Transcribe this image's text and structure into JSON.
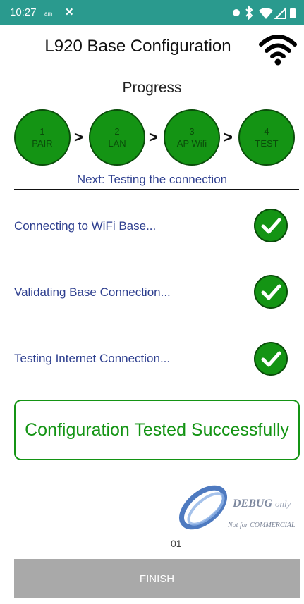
{
  "status_bar": {
    "time": "10:27",
    "ampm": "am",
    "notification_icon": "x-icon",
    "right_icons": [
      "dot-icon",
      "bluetooth-icon",
      "wifi-icon",
      "signal-icon",
      "battery-icon"
    ]
  },
  "header": {
    "title": "L920 Base Configuration",
    "icon": "wifi-icon"
  },
  "progress": {
    "label": "Progress",
    "steps": [
      {
        "number": "1",
        "label": "PAIR"
      },
      {
        "number": "2",
        "label": "LAN"
      },
      {
        "number": "3",
        "label": "AP Wifi"
      },
      {
        "number": "4",
        "label": "TEST"
      }
    ],
    "separator": ">",
    "next_text": "Next: Testing the connection"
  },
  "tasks": [
    {
      "label": "Connecting to WiFi Base...",
      "status": "done"
    },
    {
      "label": "Validating Base Connection...",
      "status": "done"
    },
    {
      "label": "Testing Internet Connection...",
      "status": "done"
    }
  ],
  "result": {
    "message": "Configuration Tested Successfully"
  },
  "watermark": {
    "main": "DEBUG",
    "suffix": "only",
    "sub": "Not for COMMERCIAL"
  },
  "footer": {
    "page_number": "01",
    "finish_label": "FINISH"
  },
  "colors": {
    "status_bar": "#2a9a8e",
    "step_fill": "#149414",
    "success": "#149414",
    "text_blue": "#2e3f8f",
    "button_disabled": "#a9a9a9"
  }
}
